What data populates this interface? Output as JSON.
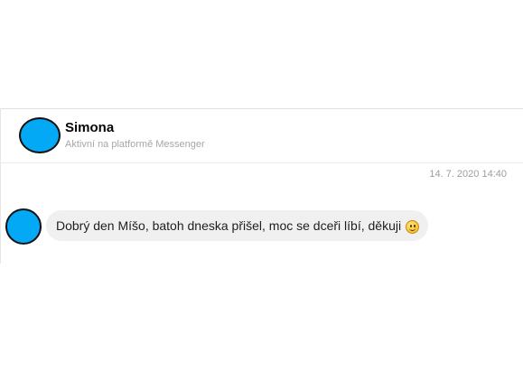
{
  "header": {
    "contact_name": "Simona",
    "status": "Aktivní na platformě Messenger"
  },
  "conversation": {
    "timestamp": "14. 7. 2020 14:40",
    "messages": [
      {
        "text": "Dobrý den Míšo, batoh dneska přišel, moc se dceři líbí, děkuji",
        "emoji": "slightly-smiling-face-icon"
      }
    ]
  },
  "colors": {
    "avatar": "#03a9f4",
    "bubble": "#f0f0f0",
    "secondary_text": "#a4a7ab"
  }
}
